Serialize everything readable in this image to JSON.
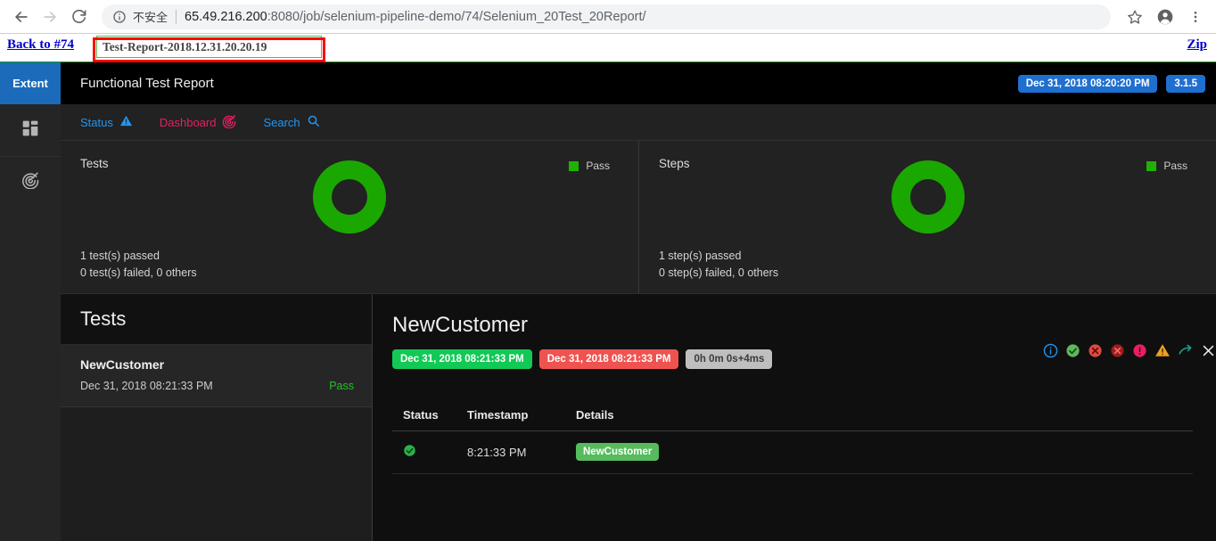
{
  "browser": {
    "back_icon": "back-arrow-icon",
    "forward_icon": "forward-arrow-icon",
    "reload_icon": "reload-icon",
    "security_label": "不安全",
    "url_host": "65.49.216.200",
    "url_path": ":8080/job/selenium-pipeline-demo/74/Selenium_20Test_20Report/",
    "bookmark_icon": "star-icon",
    "profile_icon": "account-avatar-icon",
    "menu_icon": "three-dot-menu-icon"
  },
  "page_top": {
    "back_link": "Back to #74",
    "report_name": "Test-Report-2018.12.31.20.20.19",
    "zip_link": "Zip"
  },
  "rail": {
    "brand": "Extent",
    "items": [
      {
        "icon": "dashboard-grid-icon",
        "name": "sidebar-item-dashboard"
      },
      {
        "icon": "radar-target-icon",
        "name": "sidebar-item-analysis"
      }
    ]
  },
  "header": {
    "title": "Functional Test Report",
    "timestamp_badge": "Dec 31, 2018 08:20:20 PM",
    "version_badge": "3.1.5",
    "accent": "#1f6fd0"
  },
  "tabs": [
    {
      "label": "Status",
      "icon": "warning-triangle-icon",
      "color": "#2196f3"
    },
    {
      "label": "Dashboard",
      "icon": "radar-target-icon",
      "color": "#e91e63"
    },
    {
      "label": "Search",
      "icon": "search-icon",
      "color": "#2196f3"
    }
  ],
  "cards": [
    {
      "title": "Tests",
      "legend": "Pass",
      "legend_color": "#1eb300",
      "line1": "1 test(s) passed",
      "line2": "0 test(s) failed, 0 others"
    },
    {
      "title": "Steps",
      "legend": "Pass",
      "legend_color": "#1eb300",
      "line1": "1 step(s) passed",
      "line2": "0 step(s) failed, 0 others"
    }
  ],
  "chart_data": [
    {
      "type": "pie",
      "title": "Tests",
      "categories": [
        "Pass"
      ],
      "values": [
        1
      ],
      "colors": [
        "#1aa800"
      ],
      "legend_position": "top-right",
      "annotations": [
        "1 test(s) passed",
        "0 test(s) failed, 0 others"
      ]
    },
    {
      "type": "pie",
      "title": "Steps",
      "categories": [
        "Pass"
      ],
      "values": [
        1
      ],
      "colors": [
        "#1aa800"
      ],
      "legend_position": "top-right",
      "annotations": [
        "1 step(s) passed",
        "0 step(s) failed, 0 others"
      ]
    }
  ],
  "tests_pane": {
    "heading": "Tests",
    "items": [
      {
        "name": "NewCustomer",
        "timestamp": "Dec 31, 2018 08:21:33 PM",
        "status": "Pass"
      }
    ]
  },
  "detail": {
    "title": "NewCustomer",
    "start_badge": "Dec 31, 2018 08:21:33 PM",
    "end_badge": "Dec 31, 2018 08:21:33 PM",
    "duration_badge": "0h 0m 0s+4ms",
    "icons": [
      {
        "name": "info-icon",
        "color": "#2196f3"
      },
      {
        "name": "check-circle-icon",
        "color": "#5cb85c"
      },
      {
        "name": "fail-circle-icon",
        "color": "#e04a3f"
      },
      {
        "name": "error-circle-icon",
        "color": "#9b1c1c"
      },
      {
        "name": "warning-circle-icon",
        "color": "#e91e63"
      },
      {
        "name": "warning-triangle-icon",
        "color": "#f0a020"
      },
      {
        "name": "skip-arrow-icon",
        "color": "#1f9b8e"
      },
      {
        "name": "close-icon",
        "color": "#e8e8e8"
      }
    ],
    "table": {
      "columns": [
        "Status",
        "Timestamp",
        "Details"
      ],
      "rows": [
        {
          "status_icon": "check-circle-icon",
          "timestamp": "8:21:33 PM",
          "details": "NewCustomer"
        }
      ]
    }
  }
}
